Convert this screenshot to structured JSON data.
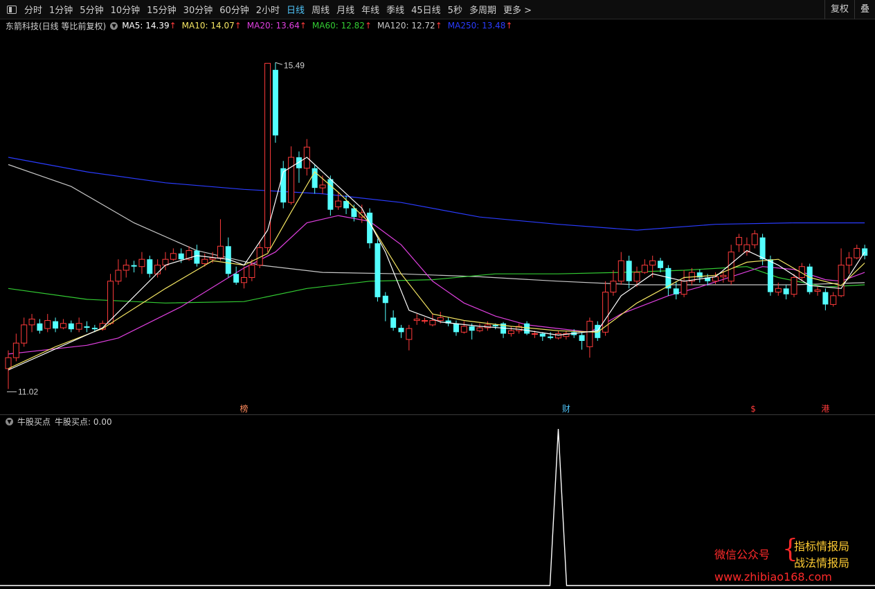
{
  "toolbar": {
    "tabs": [
      "分时",
      "1分钟",
      "5分钟",
      "10分钟",
      "15分钟",
      "30分钟",
      "60分钟",
      "2小时",
      "日线",
      "周线",
      "月线",
      "年线",
      "季线",
      "45日线",
      "5秒",
      "多周期",
      "更多 >"
    ],
    "active_index": 8,
    "right_buttons": [
      "复权",
      "叠"
    ]
  },
  "stock": {
    "title": "东箭科技(日线 等比前复权)"
  },
  "ma_legend": [
    {
      "label": "MA5: 14.39",
      "color": "#ffffff"
    },
    {
      "label": "MA10: 14.07",
      "color": "#f5e663"
    },
    {
      "label": "MA20: 13.64",
      "color": "#e040e0"
    },
    {
      "label": "MA60: 12.82",
      "color": "#33cc33"
    },
    {
      "label": "MA120: 12.72",
      "color": "#c8c8c8"
    },
    {
      "label": "MA250: 13.48",
      "color": "#2a3cff"
    }
  ],
  "ma_arrow": "↑",
  "indicator": {
    "name": "牛股买点",
    "value_label": "牛股买点: 0.00"
  },
  "watermark": {
    "left": "微信公众号",
    "brace": "{",
    "right1": "指标情报局",
    "right2": "战法情报局",
    "url": "www.zhibiao168.com"
  },
  "chart_data": {
    "type": "candlestick",
    "ylim": [
      10.9,
      15.75
    ],
    "high_label": "15.49",
    "low_label": "11.02",
    "colors": {
      "up": "#ff3b3b",
      "down": "#54ffff",
      "ma5": "#ffffff",
      "ma10": "#f5e663",
      "ma20": "#e040e0",
      "ma60": "#33cc33",
      "ma120": "#c8c8c8",
      "ma250": "#2a3cff"
    },
    "candles": [
      [
        11.3,
        11.45,
        11.55,
        11.02
      ],
      [
        11.45,
        11.65,
        11.78,
        11.4
      ],
      [
        11.65,
        11.9,
        12.0,
        11.6
      ],
      [
        11.9,
        11.98,
        12.05,
        11.8
      ],
      [
        11.92,
        11.82,
        11.98,
        11.78
      ],
      [
        11.85,
        11.96,
        12.05,
        11.8
      ],
      [
        11.95,
        11.85,
        12.0,
        11.8
      ],
      [
        11.86,
        11.92,
        11.98,
        11.84
      ],
      [
        11.92,
        11.84,
        11.96,
        11.8
      ],
      [
        11.84,
        11.92,
        12.0,
        11.8
      ],
      [
        11.88,
        11.86,
        11.95,
        11.8
      ],
      [
        11.86,
        11.84,
        11.9,
        11.8
      ],
      [
        11.84,
        11.92,
        11.96,
        11.82
      ],
      [
        11.92,
        12.5,
        12.6,
        11.9
      ],
      [
        12.5,
        12.65,
        12.8,
        12.45
      ],
      [
        12.65,
        12.72,
        12.8,
        12.55
      ],
      [
        12.72,
        12.7,
        12.78,
        12.62
      ],
      [
        12.7,
        12.8,
        12.9,
        12.6
      ],
      [
        12.8,
        12.6,
        12.85,
        12.55
      ],
      [
        12.6,
        12.72,
        12.8,
        12.55
      ],
      [
        12.72,
        12.8,
        12.9,
        12.65
      ],
      [
        12.8,
        12.88,
        12.95,
        12.78
      ],
      [
        12.88,
        12.8,
        12.95,
        12.75
      ],
      [
        12.8,
        12.92,
        12.98,
        12.78
      ],
      [
        12.92,
        12.74,
        13.0,
        12.7
      ],
      [
        12.74,
        12.8,
        12.88,
        12.7
      ],
      [
        12.8,
        12.82,
        12.9,
        12.75
      ],
      [
        12.82,
        12.98,
        13.35,
        12.78
      ],
      [
        12.98,
        12.6,
        13.1,
        12.55
      ],
      [
        12.6,
        12.48,
        12.7,
        12.45
      ],
      [
        12.48,
        12.55,
        12.7,
        12.4
      ],
      [
        12.55,
        12.72,
        12.8,
        12.5
      ],
      [
        12.72,
        12.96,
        13.05,
        12.68
      ],
      [
        12.96,
        15.49,
        15.49,
        12.9
      ],
      [
        15.4,
        14.5,
        15.5,
        14.4
      ],
      [
        14.05,
        13.58,
        14.15,
        13.5
      ],
      [
        13.58,
        14.2,
        14.35,
        13.55
      ],
      [
        14.2,
        14.05,
        14.28,
        13.85
      ],
      [
        14.05,
        14.34,
        14.45,
        13.95
      ],
      [
        14.05,
        13.78,
        14.1,
        13.7
      ],
      [
        13.78,
        13.82,
        13.95,
        13.7
      ],
      [
        13.9,
        13.48,
        13.95,
        13.4
      ],
      [
        13.52,
        13.6,
        13.72,
        13.48
      ],
      [
        13.6,
        13.5,
        13.68,
        13.42
      ],
      [
        13.5,
        13.38,
        13.55,
        13.32
      ],
      [
        13.38,
        13.44,
        13.55,
        13.3
      ],
      [
        13.44,
        13.02,
        13.5,
        12.95
      ],
      [
        13.02,
        12.28,
        13.08,
        12.22
      ],
      [
        12.3,
        12.2,
        12.35,
        11.95
      ],
      [
        12.0,
        11.86,
        12.1,
        11.82
      ],
      [
        11.86,
        11.8,
        11.9,
        11.72
      ],
      [
        11.7,
        11.85,
        11.9,
        11.55
      ],
      [
        11.96,
        11.98,
        12.05,
        11.9
      ],
      [
        11.96,
        11.96,
        12.0,
        11.92
      ],
      [
        11.9,
        11.96,
        12.05,
        11.88
      ],
      [
        11.96,
        12.0,
        12.08,
        11.92
      ],
      [
        11.96,
        11.92,
        12.0,
        11.88
      ],
      [
        11.92,
        11.8,
        11.96,
        11.75
      ],
      [
        11.8,
        11.88,
        11.95,
        11.78
      ],
      [
        11.88,
        11.82,
        11.92,
        11.7
      ],
      [
        11.82,
        11.86,
        11.92,
        11.8
      ],
      [
        11.86,
        11.9,
        11.95,
        11.82
      ],
      [
        11.9,
        11.88,
        11.92,
        11.84
      ],
      [
        11.92,
        11.78,
        11.94,
        11.72
      ],
      [
        11.78,
        11.82,
        11.88,
        11.74
      ],
      [
        11.82,
        11.88,
        11.92,
        11.78
      ],
      [
        11.92,
        11.78,
        11.95,
        11.76
      ],
      [
        11.78,
        11.78,
        11.82,
        11.72
      ],
      [
        11.78,
        11.74,
        11.8,
        11.68
      ],
      [
        11.74,
        11.72,
        11.8,
        11.7
      ],
      [
        11.72,
        11.78,
        11.82,
        11.7
      ],
      [
        11.74,
        11.78,
        11.82,
        11.7
      ],
      [
        11.8,
        11.76,
        11.84,
        11.72
      ],
      [
        11.76,
        11.68,
        11.8,
        11.56
      ],
      [
        11.6,
        11.95,
        12.0,
        11.45
      ],
      [
        11.9,
        11.72,
        11.95,
        11.68
      ],
      [
        11.8,
        12.35,
        12.5,
        11.75
      ],
      [
        12.35,
        12.5,
        12.65,
        12.3
      ],
      [
        12.5,
        12.78,
        12.9,
        12.45
      ],
      [
        12.78,
        12.5,
        12.85,
        12.4
      ],
      [
        12.5,
        12.62,
        12.7,
        12.42
      ],
      [
        12.62,
        12.72,
        12.8,
        12.6
      ],
      [
        12.72,
        12.78,
        12.85,
        12.55
      ],
      [
        12.78,
        12.68,
        12.82,
        12.62
      ],
      [
        12.68,
        12.4,
        12.72,
        12.3
      ],
      [
        12.4,
        12.32,
        12.5,
        12.25
      ],
      [
        12.32,
        12.5,
        12.65,
        12.28
      ],
      [
        12.5,
        12.62,
        12.68,
        12.44
      ],
      [
        12.62,
        12.55,
        12.66,
        12.48
      ],
      [
        12.55,
        12.5,
        12.6,
        12.44
      ],
      [
        12.5,
        12.56,
        12.62,
        12.46
      ],
      [
        12.56,
        12.58,
        12.64,
        12.48
      ],
      [
        12.5,
        12.9,
        13.0,
        12.45
      ],
      [
        13.0,
        13.1,
        13.15,
        12.9
      ],
      [
        12.9,
        13.0,
        13.1,
        12.85
      ],
      [
        13.0,
        13.15,
        13.2,
        12.95
      ],
      [
        13.1,
        12.8,
        13.15,
        12.72
      ],
      [
        12.8,
        12.35,
        12.85,
        12.3
      ],
      [
        12.35,
        12.4,
        12.48,
        12.3
      ],
      [
        12.4,
        12.32,
        12.45,
        12.25
      ],
      [
        12.32,
        12.55,
        12.6,
        12.28
      ],
      [
        12.55,
        12.7,
        12.75,
        12.5
      ],
      [
        12.7,
        12.35,
        12.74,
        12.32
      ],
      [
        12.36,
        12.38,
        12.42,
        12.3
      ],
      [
        12.35,
        12.18,
        12.4,
        12.1
      ],
      [
        12.18,
        12.3,
        12.35,
        12.15
      ],
      [
        12.3,
        12.72,
        12.95,
        12.28
      ],
      [
        12.72,
        12.82,
        12.9,
        12.6
      ],
      [
        12.82,
        12.95,
        13.0,
        12.8
      ],
      [
        12.95,
        12.85,
        13.0,
        12.8
      ]
    ],
    "ma5": [
      [
        0,
        11.28
      ],
      [
        12,
        11.86
      ],
      [
        20,
        12.72
      ],
      [
        24,
        12.85
      ],
      [
        28,
        12.8
      ],
      [
        30,
        12.72
      ],
      [
        33,
        13.2
      ],
      [
        35,
        14.0
      ],
      [
        38,
        14.2
      ],
      [
        42,
        13.8
      ],
      [
        45,
        13.5
      ],
      [
        48,
        12.9
      ],
      [
        51,
        12.1
      ],
      [
        55,
        11.94
      ],
      [
        60,
        11.88
      ],
      [
        65,
        11.84
      ],
      [
        70,
        11.76
      ],
      [
        75,
        11.82
      ],
      [
        78,
        12.3
      ],
      [
        82,
        12.6
      ],
      [
        86,
        12.5
      ],
      [
        90,
        12.56
      ],
      [
        94,
        12.92
      ],
      [
        98,
        12.72
      ],
      [
        102,
        12.44
      ],
      [
        106,
        12.4
      ],
      [
        109,
        12.9
      ]
    ],
    "ma10": [
      [
        0,
        11.3
      ],
      [
        6,
        11.6
      ],
      [
        12,
        11.85
      ],
      [
        20,
        12.4
      ],
      [
        26,
        12.78
      ],
      [
        30,
        12.72
      ],
      [
        33,
        12.88
      ],
      [
        36,
        13.45
      ],
      [
        39,
        14.0
      ],
      [
        42,
        13.72
      ],
      [
        46,
        13.3
      ],
      [
        50,
        12.6
      ],
      [
        54,
        12.05
      ],
      [
        58,
        11.96
      ],
      [
        64,
        11.88
      ],
      [
        70,
        11.82
      ],
      [
        75,
        11.8
      ],
      [
        80,
        12.2
      ],
      [
        86,
        12.55
      ],
      [
        90,
        12.58
      ],
      [
        94,
        12.76
      ],
      [
        98,
        12.8
      ],
      [
        102,
        12.55
      ],
      [
        106,
        12.44
      ],
      [
        109,
        12.75
      ]
    ],
    "ma20": [
      [
        0,
        11.5
      ],
      [
        10,
        11.62
      ],
      [
        14,
        11.72
      ],
      [
        22,
        12.15
      ],
      [
        30,
        12.68
      ],
      [
        34,
        12.9
      ],
      [
        38,
        13.3
      ],
      [
        42,
        13.4
      ],
      [
        46,
        13.32
      ],
      [
        50,
        13.0
      ],
      [
        54,
        12.5
      ],
      [
        58,
        12.2
      ],
      [
        62,
        12.02
      ],
      [
        66,
        11.9
      ],
      [
        70,
        11.85
      ],
      [
        74,
        11.8
      ],
      [
        78,
        12.05
      ],
      [
        84,
        12.3
      ],
      [
        88,
        12.42
      ],
      [
        92,
        12.56
      ],
      [
        96,
        12.7
      ],
      [
        100,
        12.66
      ],
      [
        104,
        12.52
      ],
      [
        106,
        12.5
      ],
      [
        109,
        12.62
      ]
    ],
    "ma60": [
      [
        0,
        12.4
      ],
      [
        10,
        12.25
      ],
      [
        20,
        12.2
      ],
      [
        30,
        12.22
      ],
      [
        38,
        12.4
      ],
      [
        46,
        12.5
      ],
      [
        54,
        12.52
      ],
      [
        62,
        12.6
      ],
      [
        70,
        12.6
      ],
      [
        78,
        12.62
      ],
      [
        86,
        12.65
      ],
      [
        94,
        12.7
      ],
      [
        98,
        12.55
      ],
      [
        104,
        12.42
      ],
      [
        109,
        12.45
      ]
    ],
    "ma120": [
      [
        0,
        14.1
      ],
      [
        8,
        13.8
      ],
      [
        16,
        13.3
      ],
      [
        24,
        12.92
      ],
      [
        32,
        12.72
      ],
      [
        40,
        12.62
      ],
      [
        50,
        12.6
      ],
      [
        60,
        12.56
      ],
      [
        70,
        12.5
      ],
      [
        80,
        12.45
      ],
      [
        90,
        12.45
      ],
      [
        100,
        12.45
      ],
      [
        109,
        12.48
      ]
    ],
    "ma250": [
      [
        0,
        14.2
      ],
      [
        10,
        14.0
      ],
      [
        20,
        13.85
      ],
      [
        30,
        13.76
      ],
      [
        40,
        13.7
      ],
      [
        50,
        13.58
      ],
      [
        60,
        13.38
      ],
      [
        70,
        13.28
      ],
      [
        80,
        13.2
      ],
      [
        90,
        13.28
      ],
      [
        100,
        13.3
      ],
      [
        109,
        13.3
      ]
    ],
    "markers": [
      {
        "index": 30,
        "text": "榜",
        "color": "#ff8a5c"
      },
      {
        "index": 71,
        "text": "财",
        "color": "#4fc3f7"
      },
      {
        "index": 95,
        "text": "$",
        "color": "#ff3b3b"
      },
      {
        "index": 104,
        "text": "港",
        "color": "#ff3b3b"
      }
    ],
    "indicator_series": {
      "name": "牛股买点",
      "signal_index": 70,
      "signal_value": 1.0,
      "baseline": 0.0
    }
  }
}
